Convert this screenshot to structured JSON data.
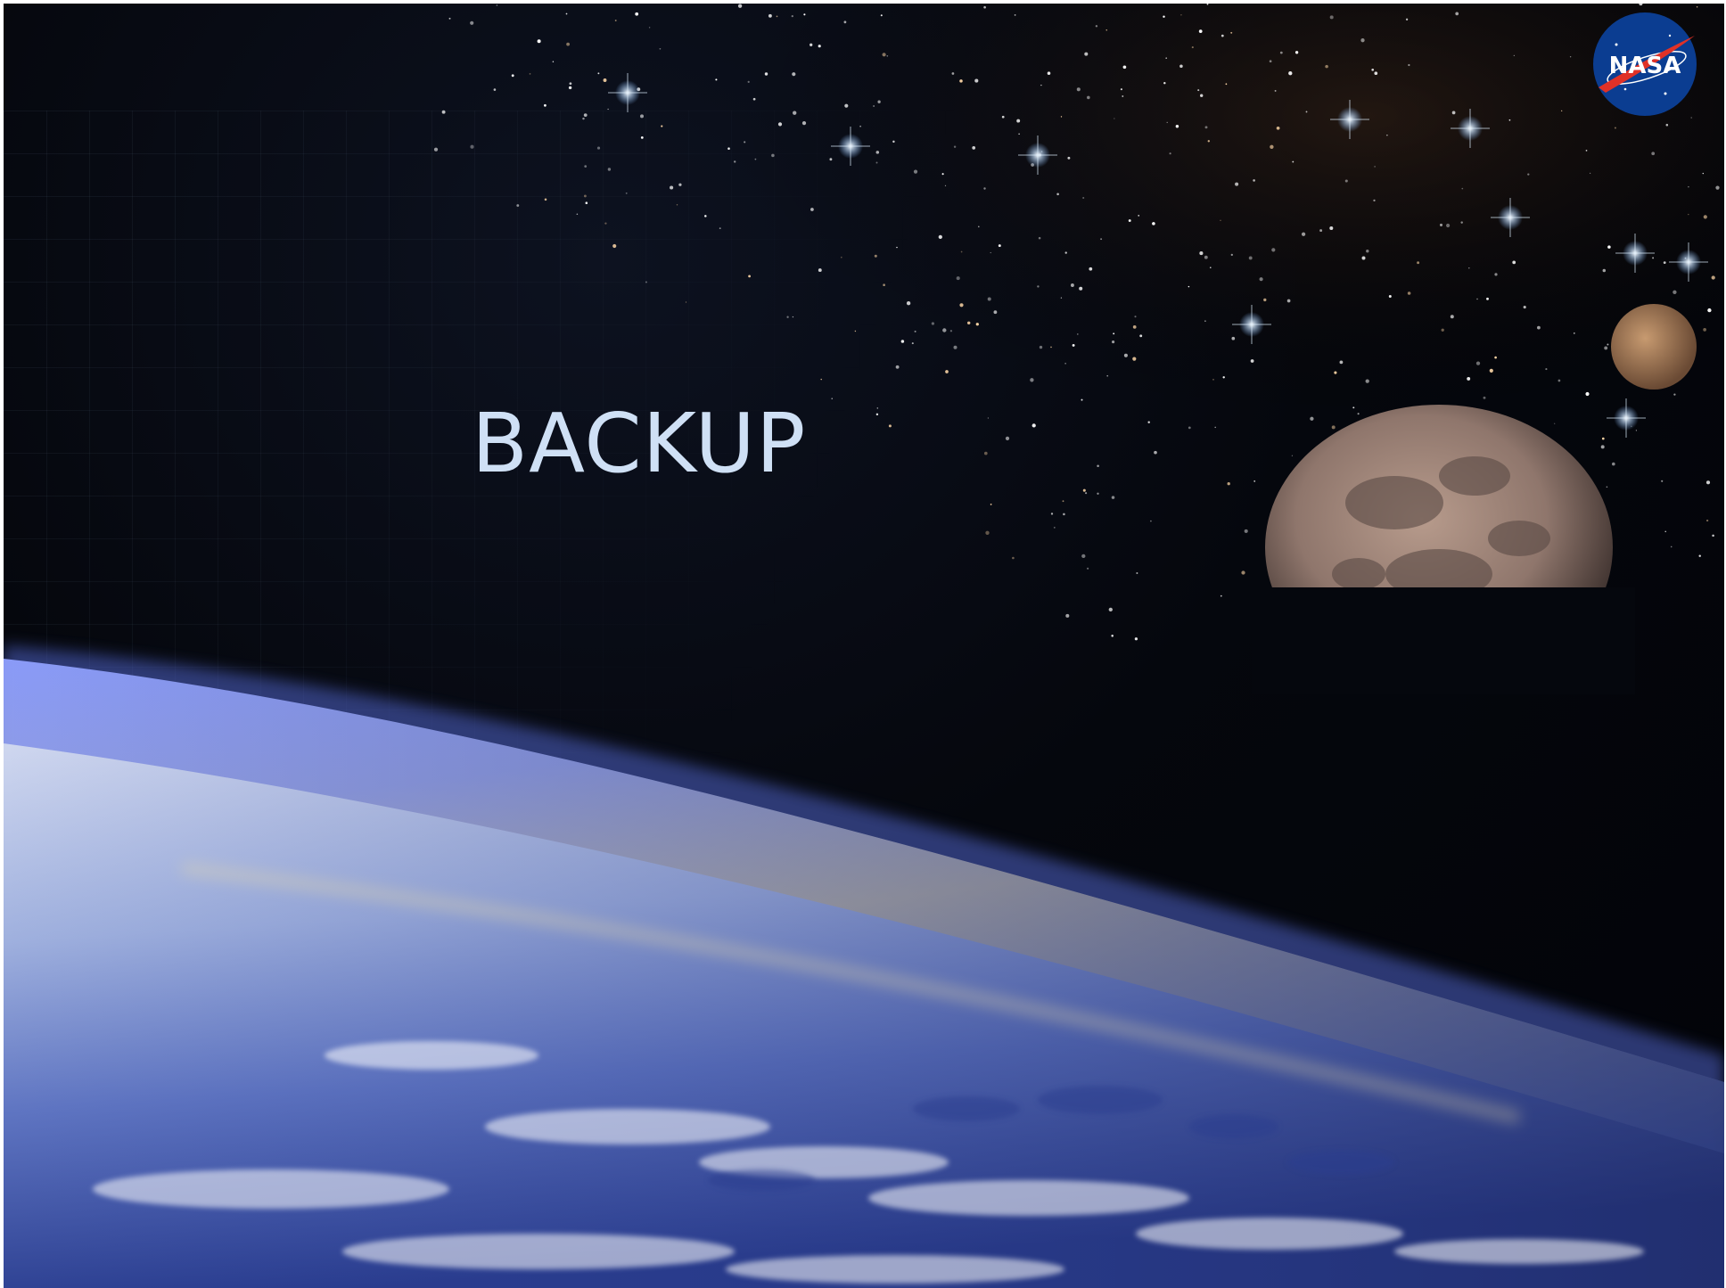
{
  "slide": {
    "title": "BACKUP",
    "logo_text": "NASA",
    "colors": {
      "title": "#cfe0f5",
      "space": "#03050b",
      "earth_glow": "#5b6fcf",
      "logo_blue": "#0b3d91",
      "logo_red": "#e03127"
    }
  },
  "icons": [
    "nasa-logo-icon",
    "moon-icon",
    "planet-icon",
    "earth-icon",
    "starfield-icon"
  ]
}
